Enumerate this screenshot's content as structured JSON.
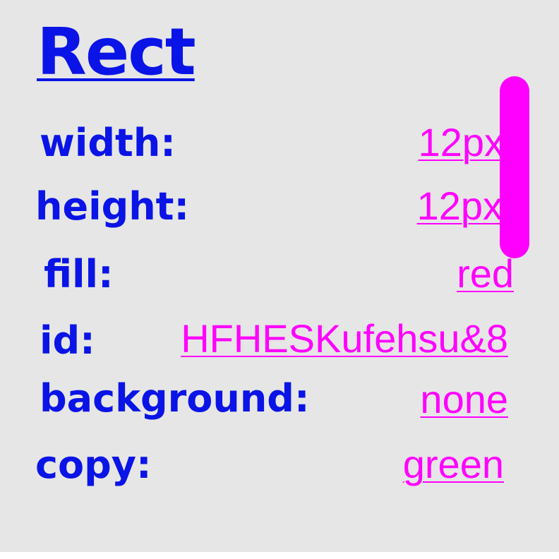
{
  "title": "Rect",
  "properties": [
    {
      "label": "width:",
      "value": "12px"
    },
    {
      "label": "height:",
      "value": "12px"
    },
    {
      "label": "fill:",
      "value": "red"
    },
    {
      "label": "id:",
      "value": "HFHESKufehsu&8"
    },
    {
      "label": "background:",
      "value": "none"
    },
    {
      "label": "copy:",
      "value": "green"
    }
  ],
  "colors": {
    "background": "#e6e6e6",
    "label": "#0a14e6",
    "value": "#ff00ff",
    "scrollbar": "#ff00ff"
  }
}
